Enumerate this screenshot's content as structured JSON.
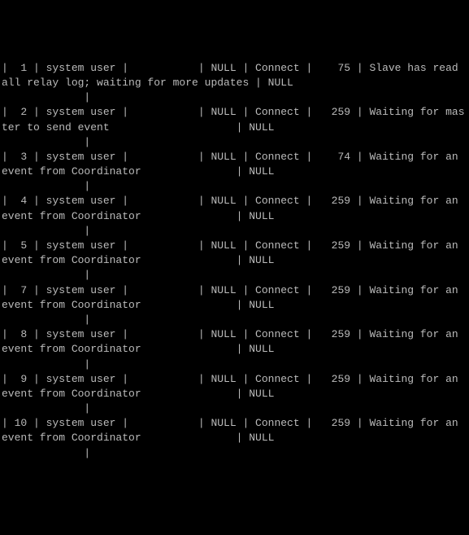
{
  "rows": [
    {
      "id": "1",
      "user": "system user",
      "host": "",
      "db": "NULL",
      "command": "Connect",
      "time": "75",
      "state": "Slave has read all relay log; waiting for more updates",
      "info": "NULL"
    },
    {
      "id": "2",
      "user": "system user",
      "host": "",
      "db": "NULL",
      "command": "Connect",
      "time": "259",
      "state": "Waiting for master to send event",
      "info": "NULL"
    },
    {
      "id": "3",
      "user": "system user",
      "host": "",
      "db": "NULL",
      "command": "Connect",
      "time": "74",
      "state": "Waiting for an event from Coordinator",
      "info": "NULL"
    },
    {
      "id": "4",
      "user": "system user",
      "host": "",
      "db": "NULL",
      "command": "Connect",
      "time": "259",
      "state": "Waiting for an event from Coordinator",
      "info": "NULL"
    },
    {
      "id": "5",
      "user": "system user",
      "host": "",
      "db": "NULL",
      "command": "Connect",
      "time": "259",
      "state": "Waiting for an event from Coordinator",
      "info": "NULL"
    },
    {
      "id": "7",
      "user": "system user",
      "host": "",
      "db": "NULL",
      "command": "Connect",
      "time": "259",
      "state": "Waiting for an event from Coordinator",
      "info": "NULL"
    },
    {
      "id": "8",
      "user": "system user",
      "host": "",
      "db": "NULL",
      "command": "Connect",
      "time": "259",
      "state": "Waiting for an event from Coordinator",
      "info": "NULL"
    },
    {
      "id": "9",
      "user": "system user",
      "host": "",
      "db": "NULL",
      "command": "Connect",
      "time": "259",
      "state": "Waiting for an event from Coordinator",
      "info": "NULL"
    },
    {
      "id": "10",
      "user": "system user",
      "host": "",
      "db": "NULL",
      "command": "Connect",
      "time": "259",
      "state": "Waiting for an event from Coordinator",
      "info": "NULL"
    }
  ]
}
